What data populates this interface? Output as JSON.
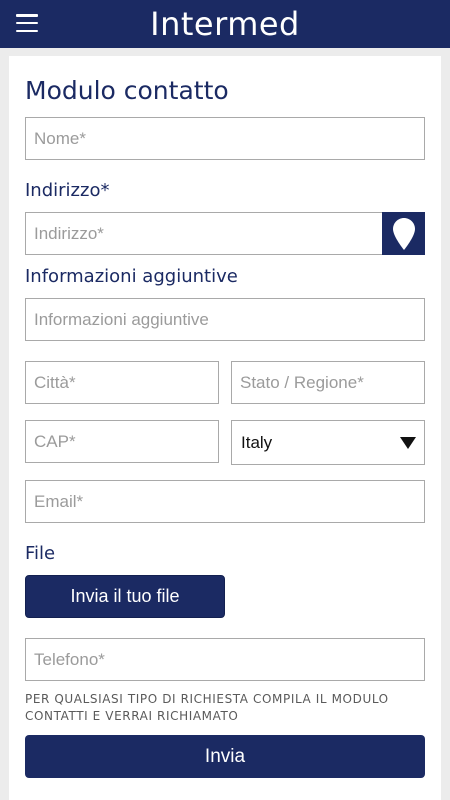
{
  "header": {
    "title": "Intermed",
    "menu_icon": "hamburger-menu-icon"
  },
  "form": {
    "title": "Modulo contatto",
    "name_placeholder": "Nome*",
    "address_label": "Indirizzo*",
    "address_placeholder": "Indirizzo*",
    "location_icon": "map-pin-icon",
    "extra_label": "Informazioni aggiuntive",
    "extra_placeholder": "Informazioni aggiuntive",
    "city_placeholder": "Città*",
    "state_placeholder": "Stato / Regione*",
    "zip_placeholder": "CAP*",
    "country_value": "Italy",
    "email_placeholder": "Email*",
    "file_label": "File",
    "file_button": "Invia il tuo file",
    "phone_placeholder": "Telefono*",
    "notice": "PER QUALSIASI TIPO DI RICHIESTA COMPILA IL MODULO CONTATTI E VERRAI RICHIAMATO",
    "submit_button": "Invia"
  },
  "colors": {
    "primary": "#1b2a63",
    "background": "#ececec",
    "border": "#a9a9a9"
  }
}
